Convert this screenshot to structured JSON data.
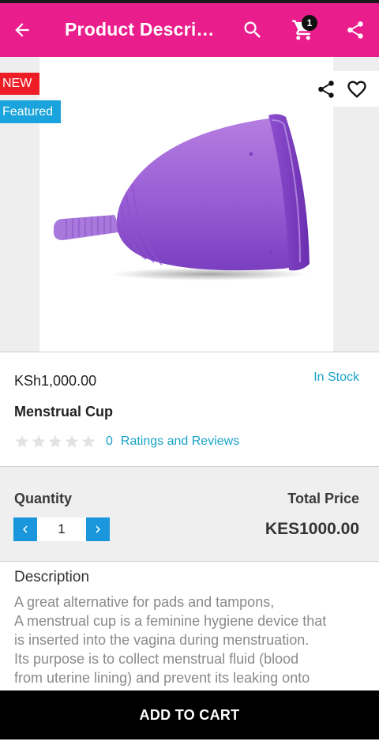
{
  "app_bar": {
    "title": "Product Descrip...",
    "cart_count": "1",
    "background": "#e91e8c",
    "icons": [
      "back-arrow-icon",
      "search-icon",
      "cart-icon",
      "share-icon"
    ]
  },
  "product_image": {
    "badges": {
      "new": "NEW",
      "featured": "Featured"
    },
    "icons": [
      "share-icon",
      "heart-icon"
    ]
  },
  "product": {
    "price": "KSh1,000.00",
    "stock": "In Stock",
    "name": "Menstrual Cup",
    "rating": {
      "stars": 0,
      "count": "0",
      "label": "Ratings and Reviews"
    }
  },
  "quantity": {
    "label": "Quantity",
    "value": "1",
    "total_label": "Total Price",
    "total_value": "KES1000.00"
  },
  "description": {
    "title": "Description",
    "lines": [
      "A great alternative for pads and tampons,",
      "A menstrual cup is a feminine hygiene device that",
      "is inserted into the vagina during menstruation.",
      "Its purpose is to collect menstrual fluid (blood",
      "from uterine lining) and prevent its leaking onto"
    ]
  },
  "footer": {
    "add_to_cart": "ADD TO CART"
  },
  "colors": {
    "accent": "#e91e8c",
    "link": "#1aa3c8",
    "stepper": "#1a96dc",
    "new_badge": "#ee1c24",
    "featured_badge": "#1aa3dc"
  }
}
